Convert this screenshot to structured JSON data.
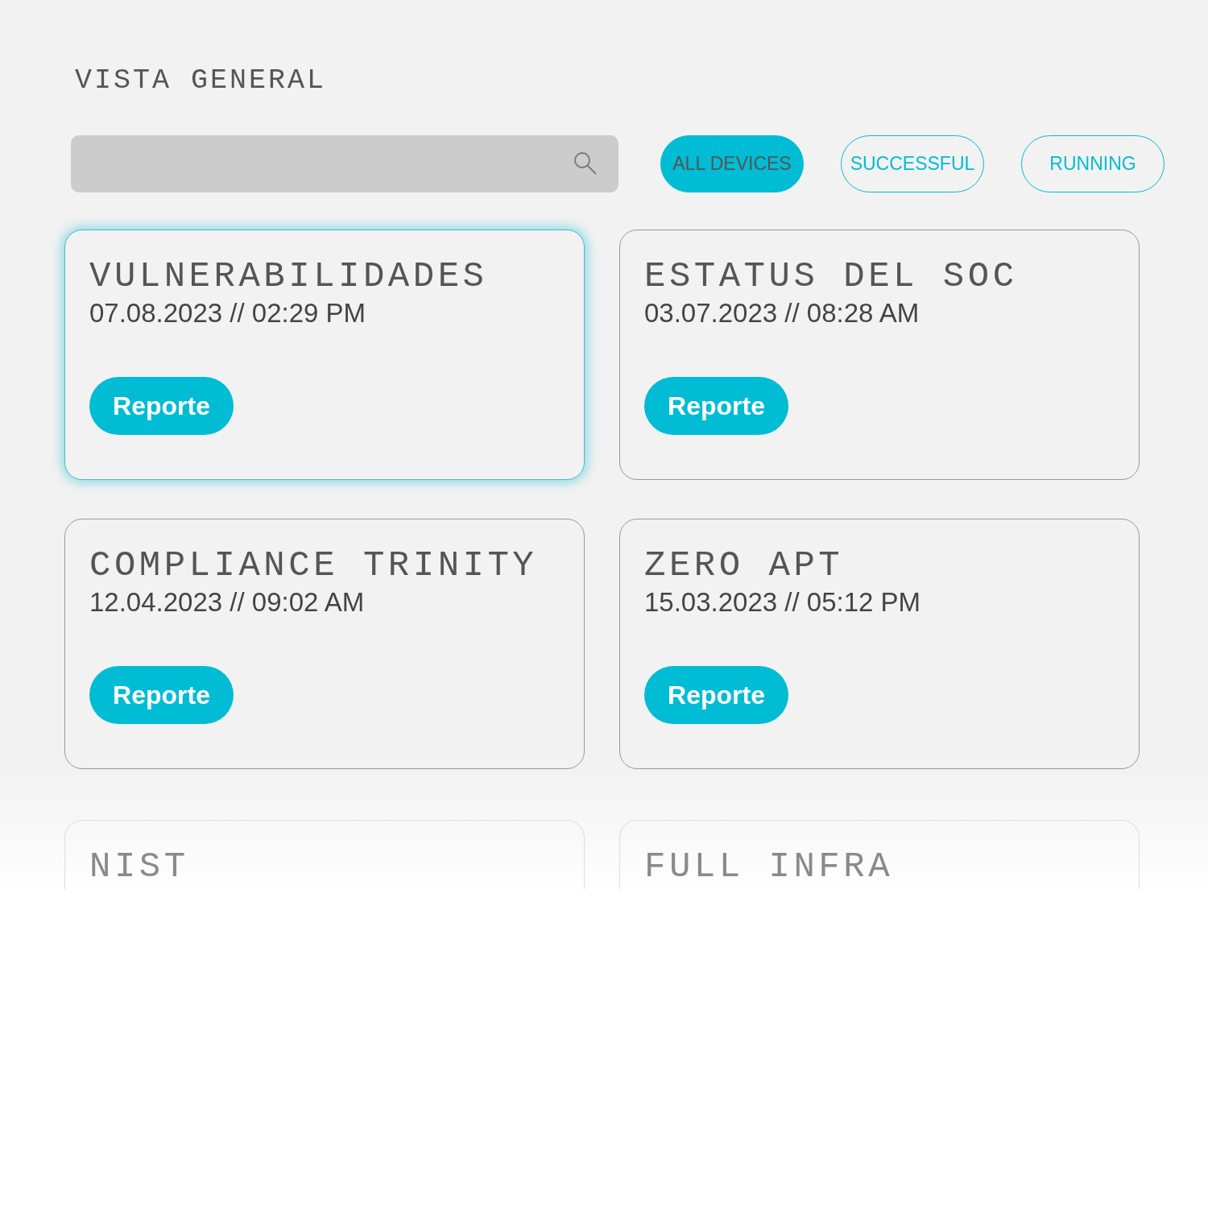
{
  "title": "VISTA GENERAL",
  "filters": [
    {
      "label": "ALL DEVICES",
      "selected": true
    },
    {
      "label": "SUCCESSFUL",
      "selected": false
    },
    {
      "label": "RUNNING",
      "selected": false
    }
  ],
  "cards": [
    {
      "title": "VULNERABILIDADES",
      "date": "07.08.2023 // 02:29 PM",
      "button": "Reporte",
      "selected": true
    },
    {
      "title": "ESTATUS DEL SOC",
      "date": "03.07.2023 // 08:28 AM",
      "button": "Reporte",
      "selected": false
    },
    {
      "title": "COMPLIANCE TRINITY",
      "date": "12.04.2023 // 09:02 AM",
      "button": "Reporte",
      "selected": false
    },
    {
      "title": "ZERO APT",
      "date": "15.03.2023 // 05:12 PM",
      "button": "Reporte",
      "selected": false
    },
    {
      "title": "NIST",
      "selected": false
    },
    {
      "title": "FULL INFRA",
      "selected": false
    }
  ]
}
